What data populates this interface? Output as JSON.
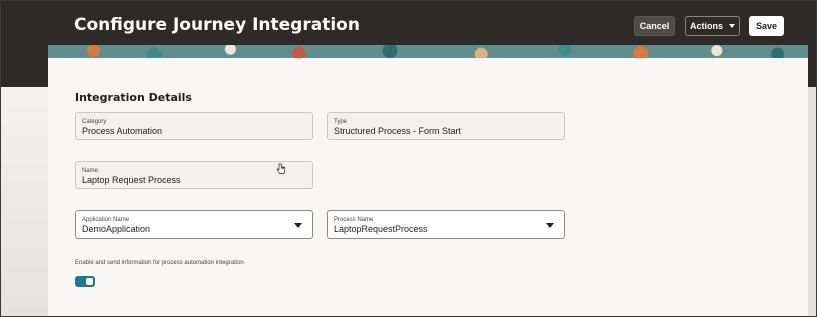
{
  "header": {
    "title": "Configure Journey Integration",
    "cancel_label": "Cancel",
    "actions_label": "Actions",
    "save_label": "Save"
  },
  "section": {
    "title": "Integration Details"
  },
  "fields": {
    "category": {
      "label": "Category",
      "value": "Process Automation"
    },
    "type": {
      "label": "Type",
      "value": "Structured Process - Form Start"
    },
    "name": {
      "label": "Name",
      "value": "Laptop Request Process"
    },
    "application_name": {
      "label": "Application Name",
      "value": "DemoApplication"
    },
    "process_name": {
      "label": "Process Name",
      "value": "LaptopRequestProcess"
    }
  },
  "toggle": {
    "label": "Enable and send information for process automation integration",
    "state": "on"
  },
  "colors": {
    "header_bg": "#2d2a28",
    "accent": "#1f7a8c"
  },
  "icons": {
    "actions_caret": "chevron-down-icon",
    "select_caret": "chevron-down-icon",
    "pointer": "hand-pointer-icon"
  }
}
